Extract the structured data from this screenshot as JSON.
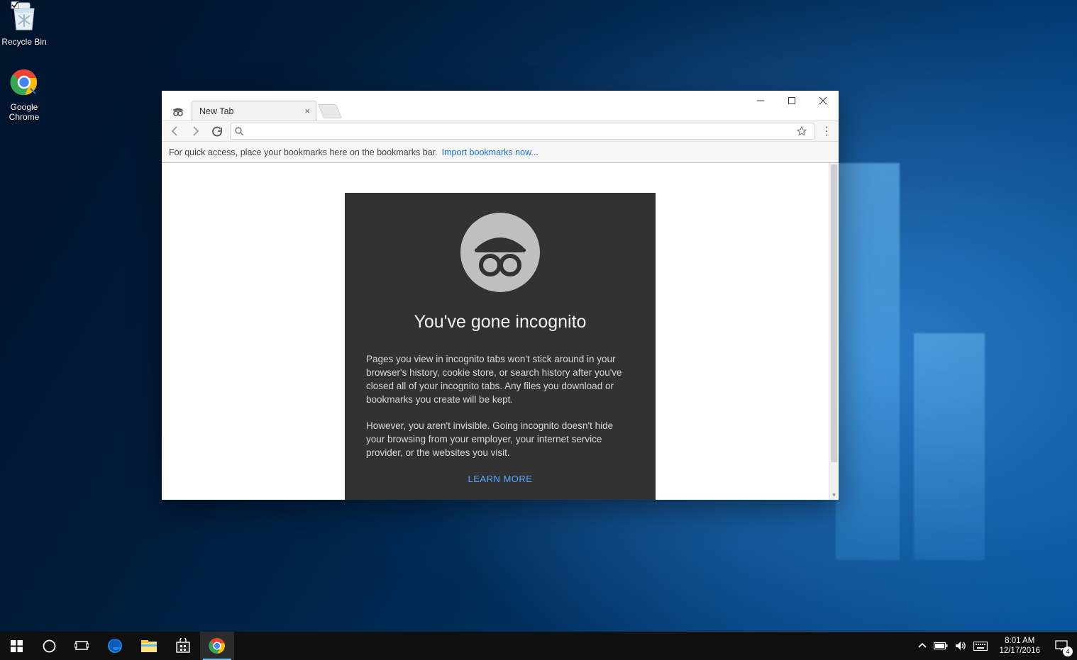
{
  "desktop": {
    "icons": {
      "recycle_bin": "Recycle Bin",
      "google_chrome": "Google\nChrome"
    }
  },
  "browser": {
    "tab_title": "New Tab",
    "bookmarks_hint": "For quick access, place your bookmarks here on the bookmarks bar.",
    "bookmarks_import_link": "Import bookmarks now...",
    "omnibox_value": ""
  },
  "incognito": {
    "title": "You've gone incognito",
    "paragraph1": "Pages you view in incognito tabs won't stick around in your browser's history, cookie store, or search history after you've closed all of your incognito tabs. Any files you download or bookmarks you create will be kept.",
    "paragraph2": "However, you aren't invisible. Going incognito doesn't hide your browsing from your employer, your internet service provider, or the websites you visit.",
    "learn_more": "LEARN MORE"
  },
  "taskbar": {
    "time": "8:01 AM",
    "date": "12/17/2016",
    "notification_count": "4"
  }
}
